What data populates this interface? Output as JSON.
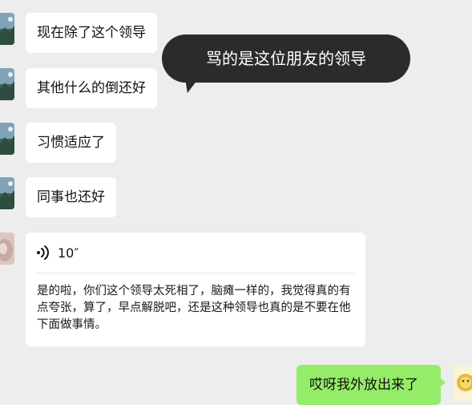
{
  "messages": [
    {
      "sender": "contact",
      "text": "现在除了这个领导"
    },
    {
      "sender": "contact",
      "text": "其他什么的倒还好"
    },
    {
      "sender": "contact",
      "text": "习惯适应了"
    },
    {
      "sender": "contact",
      "text": "同事也还好"
    }
  ],
  "voice_message": {
    "icon": "voice-wave-icon",
    "duration": "10″",
    "transcript": "是的啦，你们这个领导太死相了，脑瘫一样的，我觉得真的有点夸张，算了，早点解脱吧，还是这种领导也真的是不要在他下面做事情。"
  },
  "overlay": {
    "text": "骂的是这位朋友的领导"
  },
  "outgoing_message": {
    "sender": "me",
    "text": "哎呀我外放出来了"
  },
  "colors": {
    "background": "#ededed",
    "incoming_bubble": "#ffffff",
    "outgoing_bubble": "#95ec69",
    "overlay_bubble": "#2b2b2b"
  }
}
